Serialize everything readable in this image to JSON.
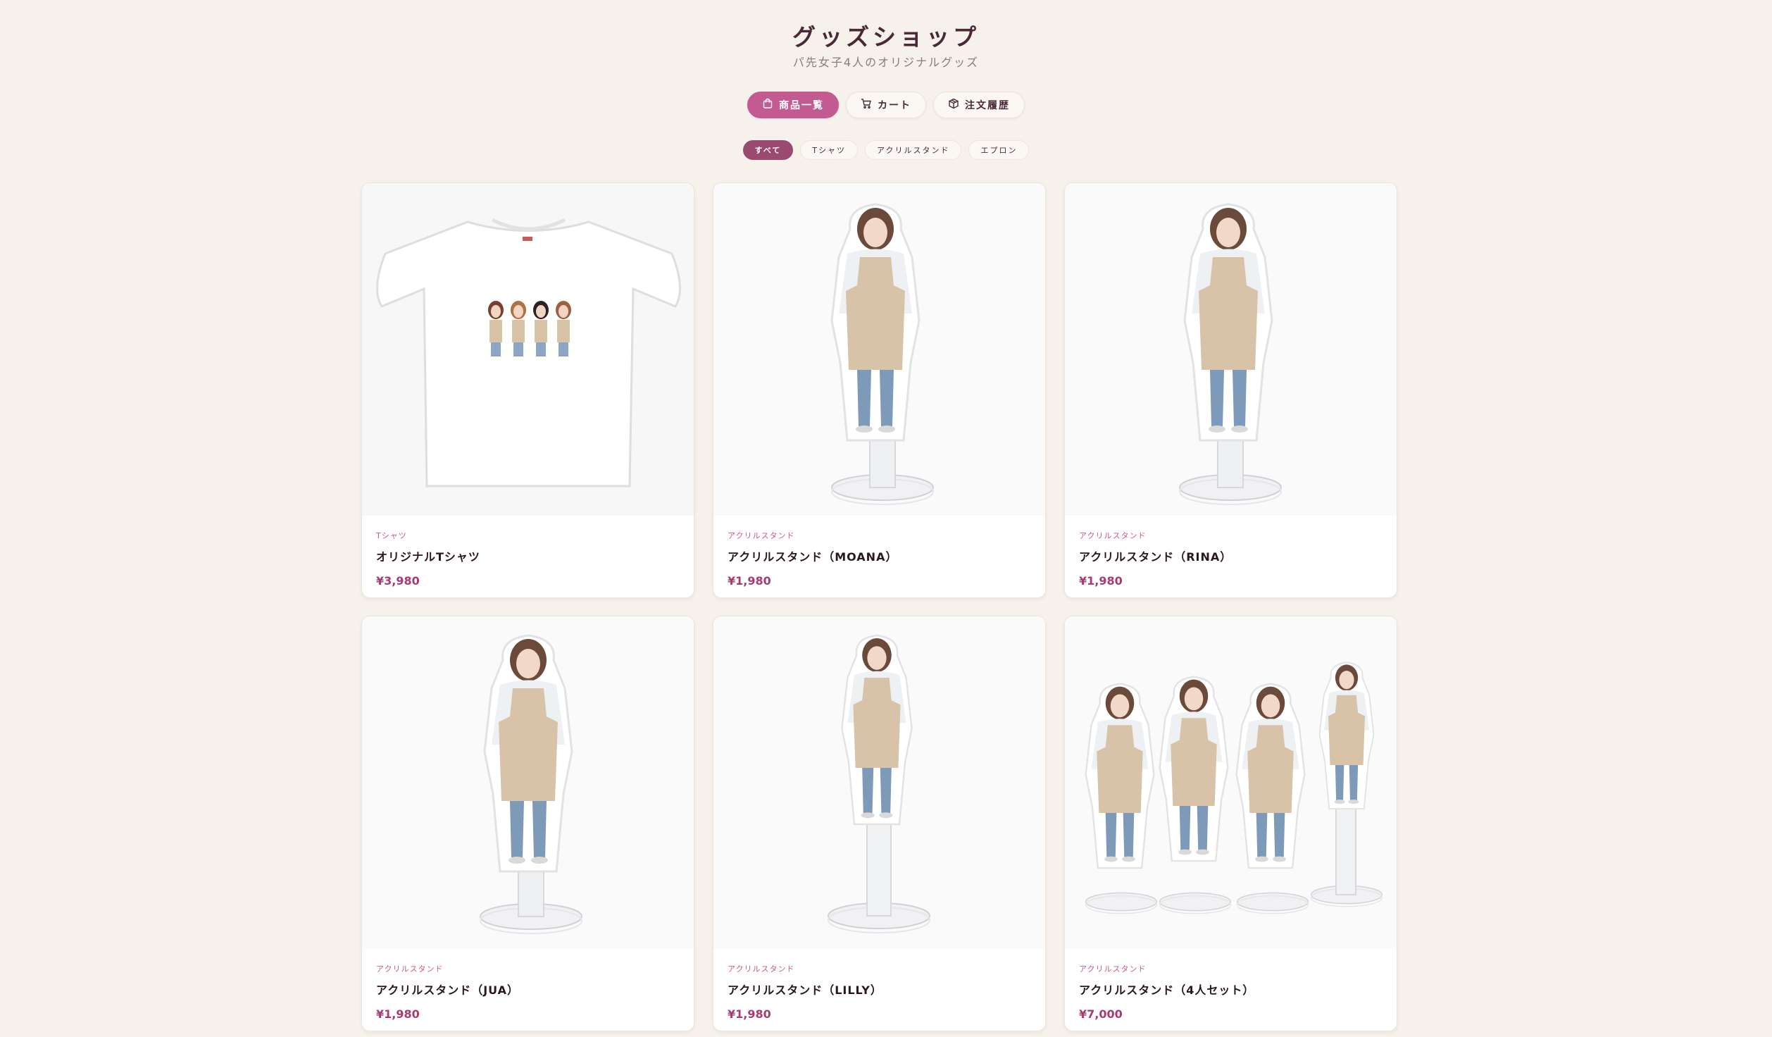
{
  "header": {
    "title": "グッズショップ",
    "subtitle": "パ先女子4人のオリジナルグッズ"
  },
  "main_tabs": [
    {
      "label": "商品一覧",
      "icon": "shopping-bag-icon",
      "active": true
    },
    {
      "label": "カート",
      "icon": "cart-icon",
      "active": false
    },
    {
      "label": "注文履歴",
      "icon": "package-icon",
      "active": false
    }
  ],
  "filters": [
    {
      "label": "すべて",
      "active": true
    },
    {
      "label": "Tシャツ",
      "active": false
    },
    {
      "label": "アクリルスタンド",
      "active": false
    },
    {
      "label": "エプロン",
      "active": false
    }
  ],
  "products": [
    {
      "category": "Tシャツ",
      "name": "オリジナルTシャツ",
      "price": "¥3,980",
      "image": "tshirt"
    },
    {
      "category": "アクリルスタンド",
      "name": "アクリルスタンド（MOANA）",
      "price": "¥1,980",
      "image": "stand-single"
    },
    {
      "category": "アクリルスタンド",
      "name": "アクリルスタンド（RINA）",
      "price": "¥1,980",
      "image": "stand-single"
    },
    {
      "category": "アクリルスタンド",
      "name": "アクリルスタンド（JUA）",
      "price": "¥1,980",
      "image": "stand-single"
    },
    {
      "category": "アクリルスタンド",
      "name": "アクリルスタンド（LILLY）",
      "price": "¥1,980",
      "image": "stand-single"
    },
    {
      "category": "アクリルスタンド",
      "name": "アクリルスタンド（4人セット）",
      "price": "¥7,000",
      "image": "stand-set"
    }
  ],
  "colors": {
    "background": "#f6f1ea",
    "accent": "#c45a92",
    "filter_active": "#9a4a70",
    "price": "#a83a72",
    "apron": "#d8c3a8",
    "jeans": "#7d9ab8"
  }
}
